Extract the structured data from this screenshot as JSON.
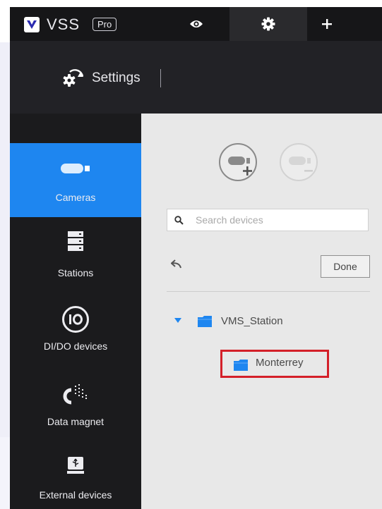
{
  "app": {
    "brand": "VSS",
    "edition": "Pro",
    "tabs": [
      {
        "id": "view",
        "icon": "eye-icon"
      },
      {
        "id": "settings",
        "icon": "gear-icon",
        "active": true
      },
      {
        "id": "add",
        "icon": "plus-icon"
      }
    ]
  },
  "header": {
    "title": "Settings"
  },
  "sidebar": {
    "items": [
      {
        "label": "Cameras",
        "icon": "camera-icon",
        "active": true
      },
      {
        "label": "Stations",
        "icon": "server-icon"
      },
      {
        "label": "DI/DO devices",
        "icon": "io-icon"
      },
      {
        "label": "Data magnet",
        "icon": "magnet-icon"
      },
      {
        "label": "External devices",
        "icon": "usb-drive-icon"
      }
    ]
  },
  "main": {
    "toolbar": {
      "add_icon": "add-camera-icon",
      "remove_icon": "remove-camera-icon"
    },
    "search": {
      "placeholder": "Search devices",
      "value": ""
    },
    "done_label": "Done",
    "tree": [
      {
        "label": "VMS_Station",
        "expanded": true,
        "children": [
          {
            "label": "Monterrey",
            "highlighted": true
          }
        ]
      }
    ]
  },
  "colors": {
    "accent": "#1e86f0",
    "highlight_border": "#d42029",
    "folder": "#1e86f0"
  }
}
